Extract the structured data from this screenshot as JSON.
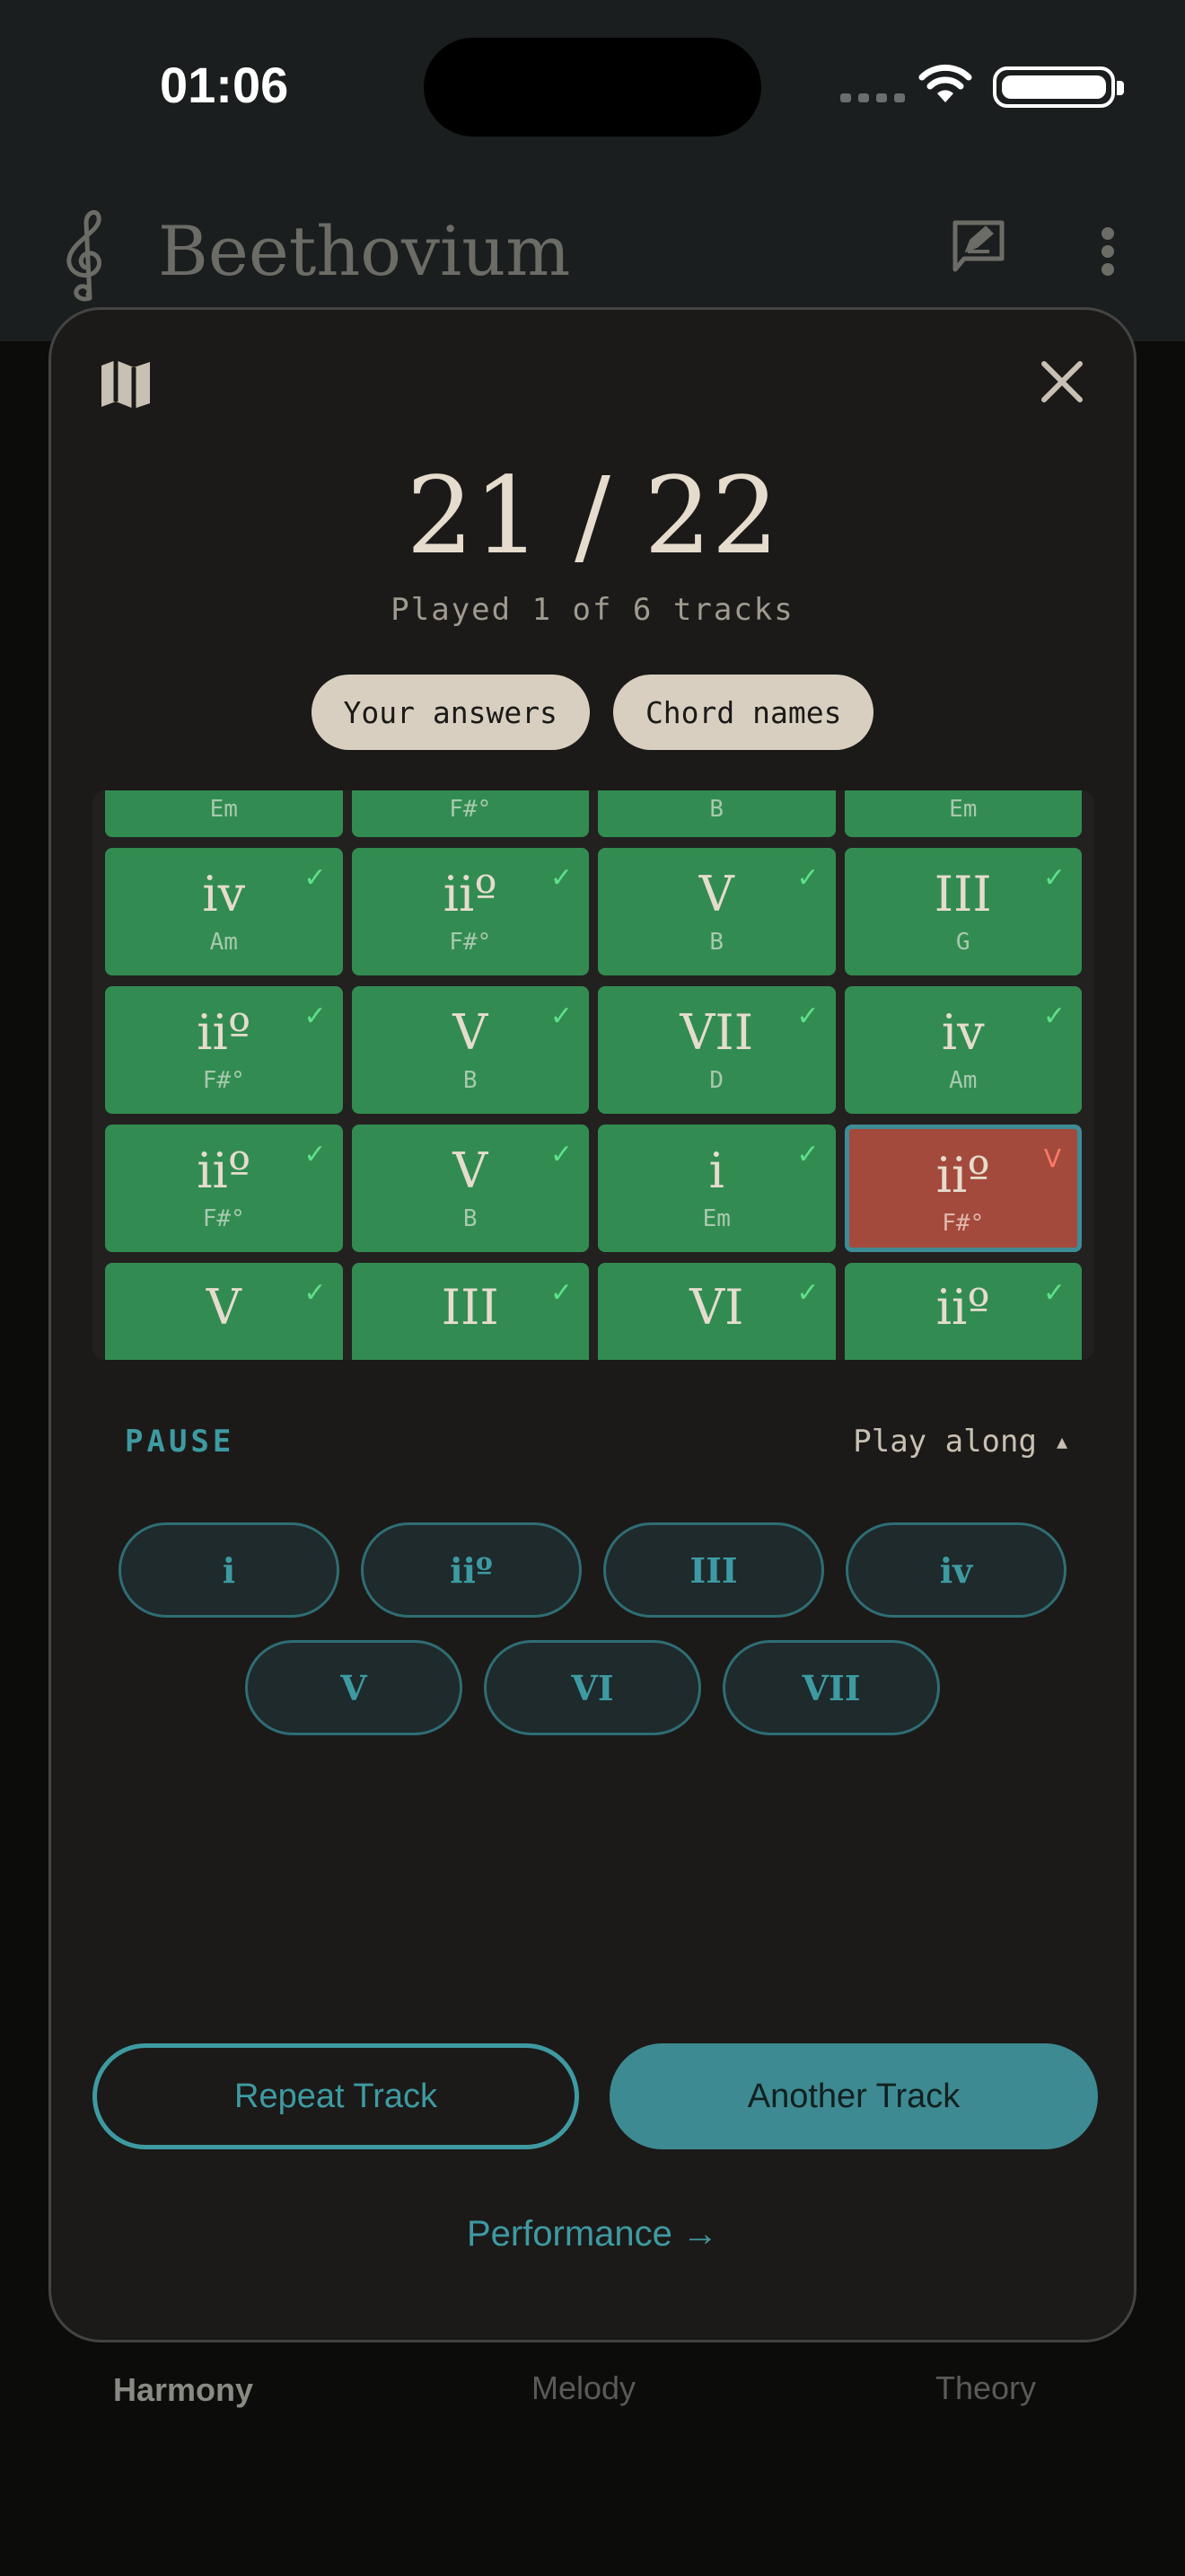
{
  "status_bar": {
    "time": "01:06"
  },
  "app": {
    "title": "Beethovium"
  },
  "modal": {
    "score": "21 / 22",
    "subtitle": "Played 1 of 6 tracks",
    "toggles": [
      "Your answers",
      "Chord names"
    ],
    "grid": {
      "top_row": [
        {
          "chord": "Em"
        },
        {
          "chord": "F#°"
        },
        {
          "chord": "B"
        },
        {
          "chord": "Em"
        }
      ],
      "rows": [
        [
          {
            "numeral": "iv",
            "chord": "Am",
            "mark": "✓",
            "correct": true
          },
          {
            "numeral": "iiº",
            "chord": "F#°",
            "mark": "✓",
            "correct": true
          },
          {
            "numeral": "V",
            "chord": "B",
            "mark": "✓",
            "correct": true
          },
          {
            "numeral": "III",
            "chord": "G",
            "mark": "✓",
            "correct": true
          }
        ],
        [
          {
            "numeral": "iiº",
            "chord": "F#°",
            "mark": "✓",
            "correct": true
          },
          {
            "numeral": "V",
            "chord": "B",
            "mark": "✓",
            "correct": true
          },
          {
            "numeral": "VII",
            "chord": "D",
            "mark": "✓",
            "correct": true
          },
          {
            "numeral": "iv",
            "chord": "Am",
            "mark": "✓",
            "correct": true
          }
        ],
        [
          {
            "numeral": "iiº",
            "chord": "F#°",
            "mark": "✓",
            "correct": true
          },
          {
            "numeral": "V",
            "chord": "B",
            "mark": "✓",
            "correct": true
          },
          {
            "numeral": "i",
            "chord": "Em",
            "mark": "✓",
            "correct": true
          },
          {
            "numeral": "iiº",
            "chord": "F#°",
            "mark": "V",
            "correct": false
          }
        ]
      ],
      "bottom_row": [
        {
          "numeral": "V",
          "mark": "✓"
        },
        {
          "numeral": "III",
          "mark": "✓"
        },
        {
          "numeral": "VI",
          "mark": "✓"
        },
        {
          "numeral": "iiº",
          "mark": "✓"
        }
      ]
    },
    "pause_label": "PAUSE",
    "play_along_label": "Play along",
    "play_along_caret": "▲",
    "answer_buttons": [
      "i",
      "iiº",
      "III",
      "iv",
      "V",
      "VI",
      "VII"
    ],
    "repeat_label": "Repeat Track",
    "another_label": "Another Track",
    "performance_label": "Performance →"
  },
  "tabs": [
    "Harmony",
    "Melody",
    "Theory"
  ],
  "colors": {
    "correct": "#328c51",
    "wrong": "#a34a3c",
    "accent": "#3e9aa2"
  }
}
